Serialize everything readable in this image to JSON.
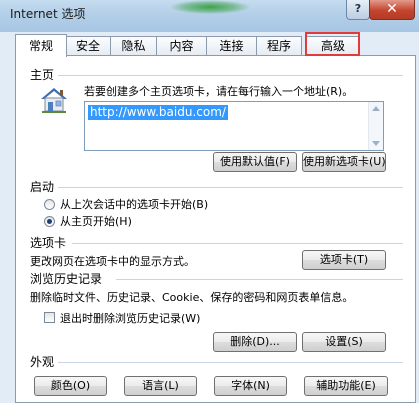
{
  "window": {
    "title": "Internet 选项",
    "help_label": "?",
    "close_label": "✕"
  },
  "tabs": [
    {
      "label": "常规",
      "active": true
    },
    {
      "label": "安全",
      "active": false
    },
    {
      "label": "隐私",
      "active": false
    },
    {
      "label": "内容",
      "active": false
    },
    {
      "label": "连接",
      "active": false
    },
    {
      "label": "程序",
      "active": false
    },
    {
      "label": "高级",
      "active": false,
      "highlighted": true
    }
  ],
  "homepage": {
    "heading": "主页",
    "icon": "house-icon",
    "description": "若要创建多个主页选项卡，请在每行输入一个地址(R)。",
    "url_value": "http://www.baidu.com/",
    "use_default_label": "使用默认值(F)",
    "use_new_tab_label": "使用新选项卡(U)"
  },
  "startup": {
    "heading": "启动",
    "option_last_session": "从上次会话中的选项卡开始(B)",
    "option_homepage": "从主页开始(H)",
    "selected": "homepage"
  },
  "tabs_section": {
    "heading": "选项卡",
    "description": "更改网页在选项卡中的显示方式。",
    "button_label": "选项卡(T)"
  },
  "history": {
    "heading": "浏览历史记录",
    "description": "删除临时文件、历史记录、Cookie、保存的密码和网页表单信息。",
    "delete_on_exit_label": "退出时删除浏览历史记录(W)",
    "delete_on_exit_checked": false,
    "delete_label": "删除(D)...",
    "settings_label": "设置(S)"
  },
  "appearance": {
    "heading": "外观",
    "colors_label": "颜色(O)",
    "languages_label": "语言(L)",
    "fonts_label": "字体(N)",
    "accessibility_label": "辅助功能(E)"
  },
  "colors": {
    "highlight_border": "#e23b3b",
    "selection_bg": "#3399ff"
  }
}
